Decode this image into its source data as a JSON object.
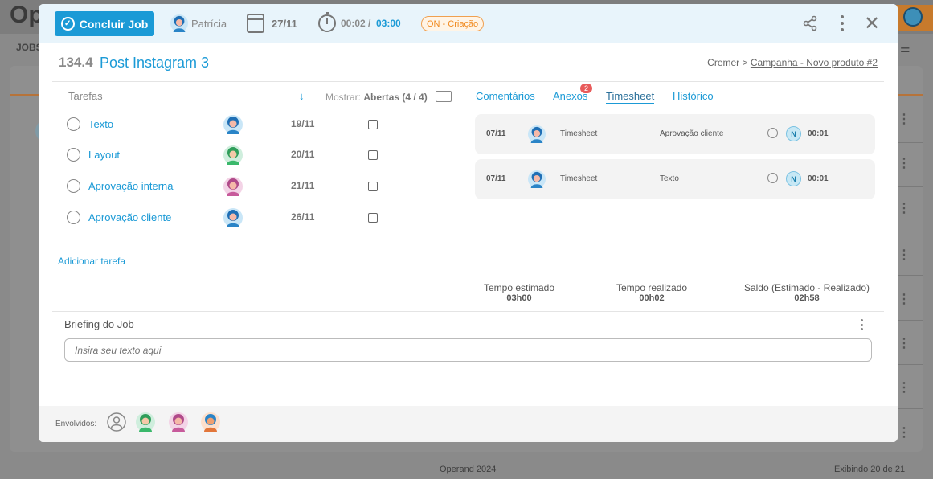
{
  "background": {
    "app_title": "Op",
    "jobs_label": "JOBS",
    "footer_left": "Operand 2024",
    "footer_right": "Exibindo 20 de 21"
  },
  "header": {
    "conclude_label": "Concluir Job",
    "user_name": "Patrícia",
    "due_date": "27/11",
    "time_spent": "00:02 /",
    "time_estimated": "03:00",
    "status": "ON - Criação"
  },
  "job": {
    "number": "134.4",
    "title": "Post Instagram 3",
    "breadcrumb_client": "Cremer",
    "breadcrumb_separator": ">",
    "breadcrumb_project": "Campanha - Novo produto #2"
  },
  "tasks": {
    "label": "Tarefas",
    "show_label": "Mostrar:",
    "show_value": "Abertas (4 / 4)",
    "items": [
      {
        "name": "Texto",
        "date": "19/11",
        "avatar": "blue"
      },
      {
        "name": "Layout",
        "date": "20/11",
        "avatar": "green"
      },
      {
        "name": "Aprovação interna",
        "date": "21/11",
        "avatar": "pink"
      },
      {
        "name": "Aprovação cliente",
        "date": "26/11",
        "avatar": "blue"
      }
    ],
    "add_label": "Adicionar tarefa"
  },
  "tabs": [
    {
      "label": "Comentários"
    },
    {
      "label": "Anexos",
      "badge": "2"
    },
    {
      "label": "Timesheet"
    },
    {
      "label": "Histórico"
    }
  ],
  "timesheet": [
    {
      "date": "07/11",
      "type": "Timesheet",
      "task": "Aprovação cliente",
      "badge": "N",
      "duration": "00:01"
    },
    {
      "date": "07/11",
      "type": "Timesheet",
      "task": "Texto",
      "badge": "N",
      "duration": "00:01"
    }
  ],
  "summary": {
    "estimated_label": "Tempo estimado",
    "estimated_value": "03h00",
    "realized_label": "Tempo realizado",
    "realized_value": "00h02",
    "balance_label": "Saldo (Estimado - Realizado)",
    "balance_value": "02h58"
  },
  "briefing": {
    "label": "Briefing do Job",
    "placeholder": "Insira seu texto aqui"
  },
  "involved": {
    "label": "Envolvidos:"
  },
  "colors": {
    "accent": "#1b9ad6",
    "status": "#f08a20",
    "badge": "#e85b5b"
  }
}
